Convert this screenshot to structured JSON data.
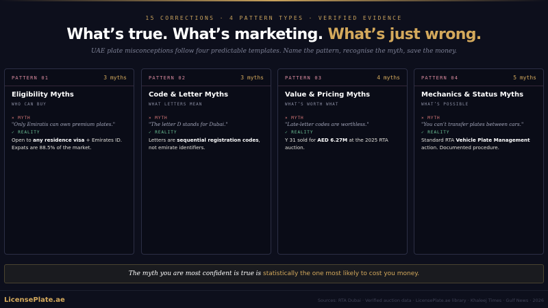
{
  "kicker": "15 CORRECTIONS · 4 PATTERN TYPES · VERIFIED EVIDENCE",
  "headline": {
    "part1": "What’s true. What’s marketing.",
    "part2": "What’s just wrong."
  },
  "subheading": "UAE plate misconceptions follow four predictable templates. Name the pattern, recognise the myth, save the money.",
  "myth_tag": "× MYTH",
  "reality_tag": "✓ REALITY",
  "cards": [
    {
      "pattern": "PATTERN 01",
      "count": "3 myths",
      "title": "Eligibility Myths",
      "subtitle": "WHO CAN BUY",
      "myth": "\"Only Emiratis can own premium plates.\"",
      "reality": [
        "Open to ",
        "any residence visa",
        " + Emirates ID. Expats are 88.5% of the market."
      ]
    },
    {
      "pattern": "PATTERN 02",
      "count": "3 myths",
      "title": "Code & Letter Myths",
      "subtitle": "WHAT LETTERS MEAN",
      "myth": "\"The letter D stands for Dubai.\"",
      "reality": [
        "Letters are ",
        "sequential registration codes",
        ", not emirate identifiers."
      ]
    },
    {
      "pattern": "PATTERN 03",
      "count": "4 myths",
      "title": "Value & Pricing Myths",
      "subtitle": "WHAT’S WORTH WHAT",
      "myth": "\"Late-letter codes are worthless.\"",
      "reality": [
        "Y 31 sold for ",
        "AED 6.27M",
        " at the 2025 RTA auction."
      ]
    },
    {
      "pattern": "PATTERN 04",
      "count": "5 myths",
      "title": "Mechanics & Status Myths",
      "subtitle": "WHAT’S POSSIBLE",
      "myth": "\"You can’t transfer plates between cars.\"",
      "reality": [
        "Standard RTA ",
        "Vehicle Plate Management",
        " action. Documented procedure."
      ]
    }
  ],
  "callout": {
    "lead": "The myth you are most confident is true is",
    "highlight": "statistically the one most likely to cost you money."
  },
  "footer": {
    "brand": "LicensePlate.ae",
    "sources": "Sources: RTA Dubai · Verified auction data · LicensePlate.ae library · Khaleej Times · Gulf News · 2026"
  }
}
